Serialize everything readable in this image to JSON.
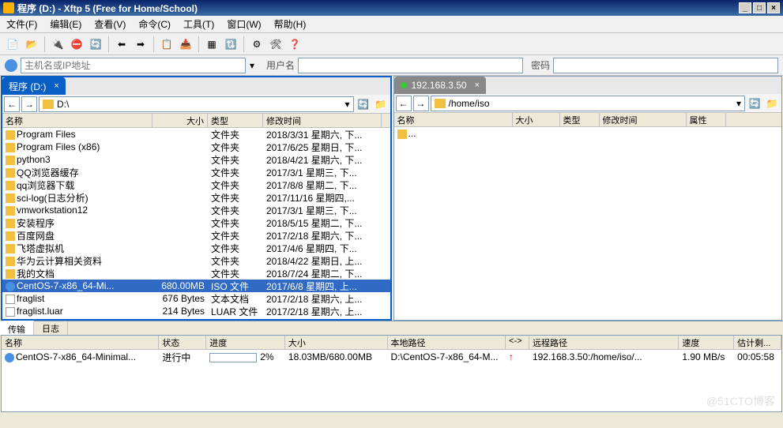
{
  "title": "程序 (D:) - Xftp 5 (Free for Home/School)",
  "menu": {
    "file": "文件(F)",
    "edit": "编辑(E)",
    "view": "查看(V)",
    "cmd": "命令(C)",
    "tools": "工具(T)",
    "window": "窗口(W)",
    "help": "帮助(H)"
  },
  "address": {
    "placeholder": "主机名或IP地址",
    "user_label": "用户名",
    "pass_label": "密码"
  },
  "left": {
    "tab": "程序 (D:)",
    "path": "D:\\",
    "cols": {
      "name": "名称",
      "size": "大小",
      "type": "类型",
      "date": "修改时间"
    },
    "rows": [
      {
        "name": "Program Files",
        "size": "",
        "type": "文件夹",
        "date": "2018/3/31 星期六, 下...",
        "icon": "folder"
      },
      {
        "name": "Program Files (x86)",
        "size": "",
        "type": "文件夹",
        "date": "2017/6/25 星期日, 下...",
        "icon": "folder"
      },
      {
        "name": "python3",
        "size": "",
        "type": "文件夹",
        "date": "2018/4/21 星期六, 下...",
        "icon": "folder"
      },
      {
        "name": "QQ浏览器缓存",
        "size": "",
        "type": "文件夹",
        "date": "2017/3/1 星期三, 下...",
        "icon": "folder"
      },
      {
        "name": "qq浏览器下载",
        "size": "",
        "type": "文件夹",
        "date": "2017/8/8 星期二, 下...",
        "icon": "folder"
      },
      {
        "name": "sci-log(日志分析)",
        "size": "",
        "type": "文件夹",
        "date": "2017/11/16 星期四,...",
        "icon": "folder"
      },
      {
        "name": "vmworkstation12",
        "size": "",
        "type": "文件夹",
        "date": "2017/3/1 星期三, 下...",
        "icon": "folder"
      },
      {
        "name": "安装程序",
        "size": "",
        "type": "文件夹",
        "date": "2018/5/15 星期二, 下...",
        "icon": "folder"
      },
      {
        "name": "百度网盘",
        "size": "",
        "type": "文件夹",
        "date": "2017/2/18 星期六, 下...",
        "icon": "folder"
      },
      {
        "name": "飞塔虚拟机",
        "size": "",
        "type": "文件夹",
        "date": "2017/4/6 星期四, 下...",
        "icon": "folder"
      },
      {
        "name": "华为云计算相关资料",
        "size": "",
        "type": "文件夹",
        "date": "2018/4/22 星期日, 上...",
        "icon": "folder"
      },
      {
        "name": "我的文档",
        "size": "",
        "type": "文件夹",
        "date": "2018/7/24 星期二, 下...",
        "icon": "folder"
      },
      {
        "name": "CentOS-7-x86_64-Mi...",
        "size": "680.00MB",
        "type": "ISO 文件",
        "date": "2017/6/8 星期四, 上...",
        "icon": "iso",
        "sel": true
      },
      {
        "name": "fraglist",
        "size": "676 Bytes",
        "type": "文本文档",
        "date": "2017/2/18 星期六, 上...",
        "icon": "file"
      },
      {
        "name": "fraglist.luar",
        "size": "214 Bytes",
        "type": "LUAR 文件",
        "date": "2017/2/18 星期六, 上...",
        "icon": "file"
      }
    ]
  },
  "right": {
    "tab": "192.168.3.50",
    "path": "/home/iso",
    "cols": {
      "name": "名称",
      "size": "大小",
      "type": "类型",
      "date": "修改时间",
      "attr": "属性"
    },
    "rows": [
      {
        "name": "...",
        "icon": "folder"
      }
    ]
  },
  "bottom_tabs": {
    "transfer": "传输",
    "log": "日志"
  },
  "transfer": {
    "cols": {
      "name": "名称",
      "status": "状态",
      "progress": "进度",
      "size": "大小",
      "local": "本地路径",
      "dir": "<->",
      "remote": "远程路径",
      "speed": "速度",
      "eta": "估计剩..."
    },
    "row": {
      "name": "CentOS-7-x86_64-Minimal...",
      "status": "进行中",
      "progress": "2%",
      "size": "18.03MB/680.00MB",
      "local": "D:\\CentOS-7-x86_64-M...",
      "remote": "192.168.3.50:/home/iso/...",
      "speed": "1.90 MB/s",
      "eta": "00:05:58"
    }
  },
  "watermark": "@51CTO博客"
}
